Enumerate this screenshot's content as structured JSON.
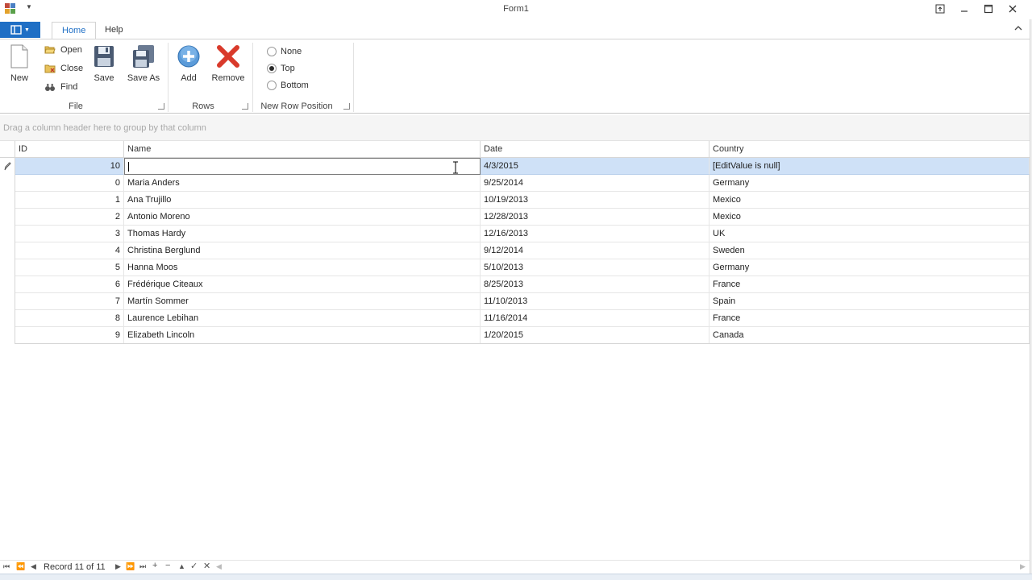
{
  "window": {
    "title": "Form1",
    "qat_icon": "chevron-down-icon",
    "controls": [
      "restore-up-icon",
      "minimize-icon",
      "maximize-icon",
      "close-icon"
    ]
  },
  "ribbon": {
    "tabs": [
      {
        "label": "Home",
        "active": true
      },
      {
        "label": "Help",
        "active": false
      }
    ],
    "groups": {
      "file": {
        "label": "File",
        "new_label": "New",
        "open_label": "Open",
        "close_label": "Close",
        "find_label": "Find",
        "save_label": "Save",
        "save_as_label": "Save As"
      },
      "rows": {
        "label": "Rows",
        "add_label": "Add",
        "remove_label": "Remove"
      },
      "new_row_position": {
        "label": "New Row Position",
        "options": [
          "None",
          "Top",
          "Bottom"
        ],
        "selected": "Top"
      }
    }
  },
  "grid": {
    "group_panel_hint": "Drag a column header here to group by that column",
    "columns": [
      "ID",
      "Name",
      "Date",
      "Country"
    ],
    "new_row": {
      "id": "10",
      "name": "",
      "date": "4/3/2015",
      "country": "[EditValue is null]"
    },
    "rows": [
      {
        "id": "0",
        "name": "Maria Anders",
        "date": "9/25/2014",
        "country": "Germany"
      },
      {
        "id": "1",
        "name": "Ana Trujillo",
        "date": "10/19/2013",
        "country": "Mexico"
      },
      {
        "id": "2",
        "name": "Antonio Moreno",
        "date": "12/28/2013",
        "country": "Mexico"
      },
      {
        "id": "3",
        "name": "Thomas Hardy",
        "date": "12/16/2013",
        "country": "UK"
      },
      {
        "id": "4",
        "name": "Christina Berglund",
        "date": "9/12/2014",
        "country": "Sweden"
      },
      {
        "id": "5",
        "name": "Hanna Moos",
        "date": "5/10/2013",
        "country": "Germany"
      },
      {
        "id": "6",
        "name": "Frédérique Citeaux",
        "date": "8/25/2013",
        "country": "France"
      },
      {
        "id": "7",
        "name": "Martín Sommer",
        "date": "11/10/2013",
        "country": "Spain"
      },
      {
        "id": "8",
        "name": "Laurence Lebihan",
        "date": "11/16/2014",
        "country": "France"
      },
      {
        "id": "9",
        "name": "Elizabeth Lincoln",
        "date": "1/20/2015",
        "country": "Canada"
      }
    ]
  },
  "navigator": {
    "record_text": "Record 11 of 11"
  },
  "colors": {
    "accent": "#1f6fc5",
    "selected_row": "#cfe1f7"
  }
}
